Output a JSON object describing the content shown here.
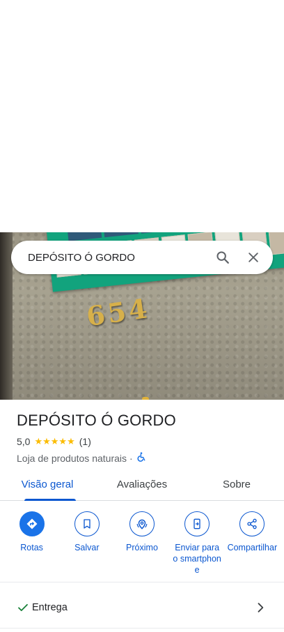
{
  "search": {
    "query": "DEPÓSITO Ó GORDO",
    "search_icon": "search-icon",
    "close_icon": "close-icon"
  },
  "photo": {
    "house_number": "654"
  },
  "place": {
    "name": "DEPÓSITO Ó GORDO",
    "rating": "5,0",
    "stars": "★★★★★",
    "review_count": "(1)",
    "category": "Loja de produtos naturais",
    "separator": "·",
    "accessibility_icon": "wheelchair-icon"
  },
  "tabs": [
    {
      "label": "Visão geral",
      "active": true
    },
    {
      "label": "Avaliações",
      "active": false
    },
    {
      "label": "Sobre",
      "active": false
    }
  ],
  "actions": [
    {
      "label": "Rotas",
      "icon": "directions-icon"
    },
    {
      "label": "Salvar",
      "icon": "bookmark-icon"
    },
    {
      "label": "Próximo",
      "icon": "nearby-icon"
    },
    {
      "label": "Enviar para o smartphone",
      "icon": "send-to-phone-icon"
    },
    {
      "label": "Compartilhar",
      "icon": "share-icon"
    }
  ],
  "details": {
    "delivery_label": "Entrega",
    "delivery_icon": "check-icon",
    "chevron_icon": "chevron-right-icon"
  },
  "colors": {
    "accent": "#0b57d0",
    "star": "#fbbc04",
    "directions_fill": "#1a73e8",
    "check": "#188038"
  }
}
